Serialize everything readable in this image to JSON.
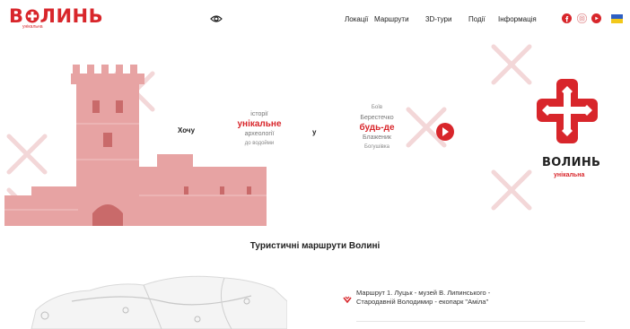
{
  "header": {
    "logo_text_a": "В",
    "logo_text_b": "ЛИНЬ",
    "logo_subtitle": "унікальна",
    "nav": [
      "Локації",
      "Маршрути",
      "3D-тури",
      "Події",
      "Інформація"
    ],
    "social_icons": [
      "facebook-icon",
      "instagram-icon",
      "youtube-icon"
    ],
    "language_flag": "ukraine-flag"
  },
  "hero": {
    "want_label": "Хочу",
    "left_phrase": {
      "line1": "історії",
      "accent": "унікальне",
      "line3": "археології",
      "line4": "до водойми"
    },
    "conjunction": "у",
    "right_phrase": {
      "line1": "Боїв",
      "line2": "Берестечко",
      "accent": "будь-де",
      "line4": "Блаженик",
      "line5": "Богушівка"
    },
    "brand_title": "ВОЛИНЬ",
    "brand_subtitle": "унікальна"
  },
  "routes": {
    "section_title": "Туристичні маршрути Волині",
    "items": [
      {
        "line1": "Маршрут 1. Луцьк - музей В. Липинського -",
        "line2": "Стародавній Володимир - екопарк \"Аміла\""
      }
    ]
  },
  "colors": {
    "brand_red": "#d8262b",
    "text_dark": "#222222",
    "flag_blue": "#2d5fc4",
    "flag_yellow": "#f2c81a"
  }
}
